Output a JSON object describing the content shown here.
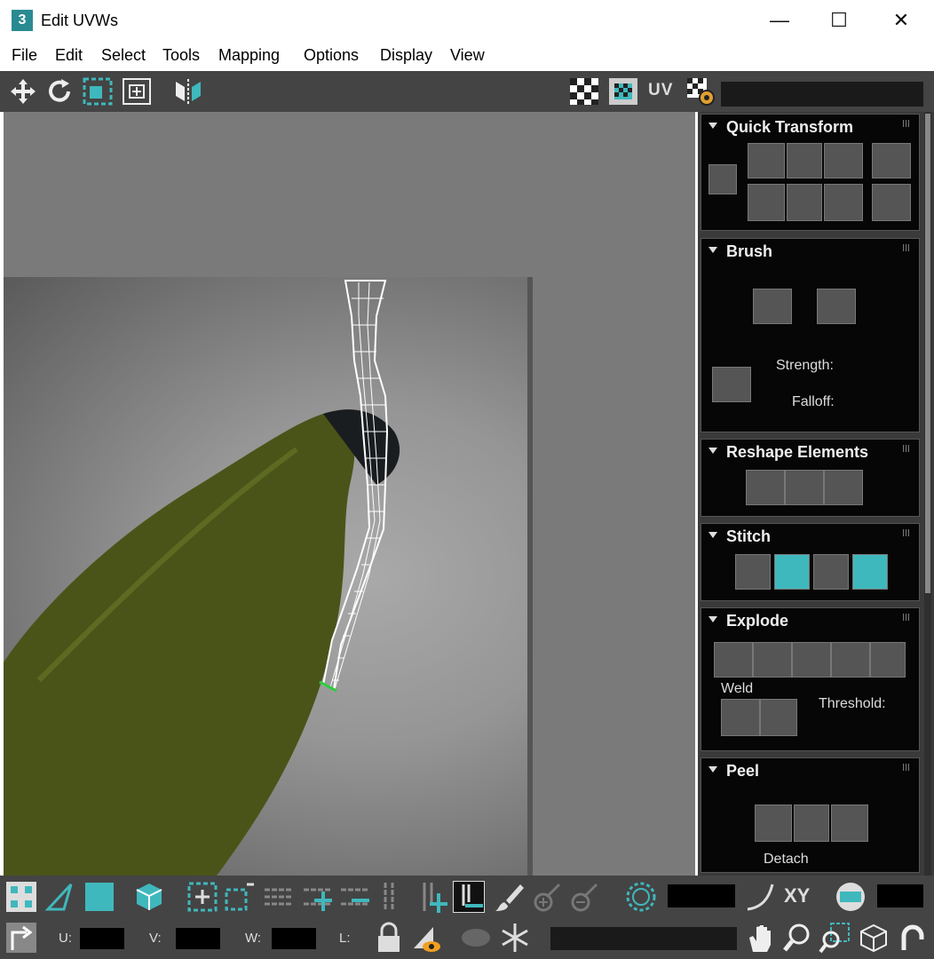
{
  "window": {
    "title": "Edit UVWs",
    "app_icon_label": "3",
    "minimize": "—",
    "maximize": "☐",
    "close": "✕"
  },
  "menu": [
    "File",
    "Edit",
    "Select",
    "Tools",
    "Mapping",
    "Options",
    "Display",
    "View"
  ],
  "toolbar": {
    "uv_label": "UV",
    "icons": [
      "move-icon",
      "rotate-icon",
      "scale-icon",
      "freeform-icon",
      "mirror-icon",
      "checker-pattern-icon",
      "checker-texture-icon",
      "uv-options-icon"
    ]
  },
  "colors": {
    "accent": "#3fb8bd",
    "panel_bg": "#060606",
    "toolbar_bg": "#444444",
    "viewport_bg": "#7a7a7a"
  },
  "rollouts": {
    "quick_transform": {
      "title": "Quick Transform"
    },
    "brush": {
      "title": "Brush",
      "strength": "Strength:",
      "falloff": "Falloff:"
    },
    "reshape": {
      "title": "Reshape Elements"
    },
    "stitch": {
      "title": "Stitch"
    },
    "explode": {
      "title": "Explode",
      "weld": "Weld",
      "threshold": "Threshold:"
    },
    "peel": {
      "title": "Peel",
      "detach": "Detach"
    }
  },
  "bottom": {
    "xy_label": "XY",
    "u_label": "U:",
    "v_label": "V:",
    "w_label": "W:",
    "l_label": "L:"
  }
}
